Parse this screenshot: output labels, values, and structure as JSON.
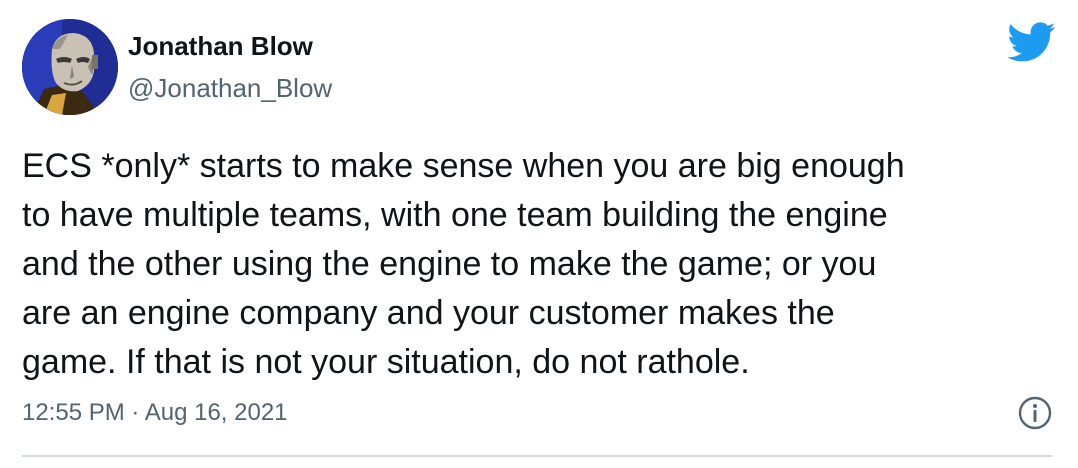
{
  "author": {
    "name": "Jonathan Blow",
    "handle": "@Jonathan_Blow",
    "avatar_icon": "pixel-art-portrait"
  },
  "brand": {
    "icon": "twitter-bird-icon",
    "color": "#1d9bf0"
  },
  "tweet": {
    "text": "ECS *only* starts to make sense when you are big enough\nto have multiple teams, with one team building the engine\nand the other using the engine to make the game; or you\nare an engine company and your customer makes the\ngame. If that is not your situation, do not rathole.",
    "timestamp": "12:55 PM · Aug 16, 2021"
  },
  "actions": {
    "info_icon": "info-icon"
  },
  "colors": {
    "text_primary": "#0f1419",
    "text_secondary": "#536471",
    "divider": "#cfd9de"
  }
}
